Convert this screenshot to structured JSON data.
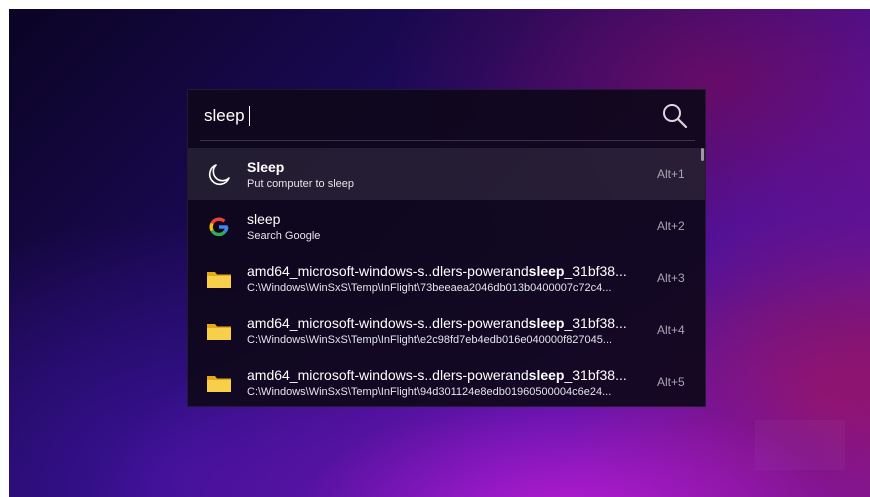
{
  "search": {
    "value": "sleep",
    "shortcut_label": ""
  },
  "results": [
    {
      "title_plain": "",
      "title_bold": "Sleep",
      "title_tail": "",
      "subtitle": "Put computer to sleep",
      "shortcut": "Alt+1",
      "icon": "moon-icon"
    },
    {
      "title_plain": "sleep",
      "title_bold": "",
      "title_tail": "",
      "subtitle": "Search Google",
      "shortcut": "Alt+2",
      "icon": "google-icon"
    },
    {
      "title_plain": "amd64_microsoft-windows-s..dlers-powerand",
      "title_bold": "sleep",
      "title_tail": "_31bf38...",
      "subtitle": "C:\\Windows\\WinSxS\\Temp\\InFlight\\73beeaea2046db013b0400007c72c4...",
      "shortcut": "Alt+3",
      "icon": "folder-icon"
    },
    {
      "title_plain": "amd64_microsoft-windows-s..dlers-powerand",
      "title_bold": "sleep",
      "title_tail": "_31bf38...",
      "subtitle": "C:\\Windows\\WinSxS\\Temp\\InFlight\\e2c98fd7eb4edb016e040000f827045...",
      "shortcut": "Alt+4",
      "icon": "folder-icon"
    },
    {
      "title_plain": "amd64_microsoft-windows-s..dlers-powerand",
      "title_bold": "sleep",
      "title_tail": "_31bf38...",
      "subtitle": "C:\\Windows\\WinSxS\\Temp\\InFlight\\94d301124e8edb01960500004c6e24...",
      "shortcut": "Alt+5",
      "icon": "folder-icon"
    }
  ],
  "colors": {
    "panel": "#0e081a",
    "selected_row": "#2a2535",
    "folder": "#f4c542",
    "shortcut_text": "#a8a6b3"
  }
}
